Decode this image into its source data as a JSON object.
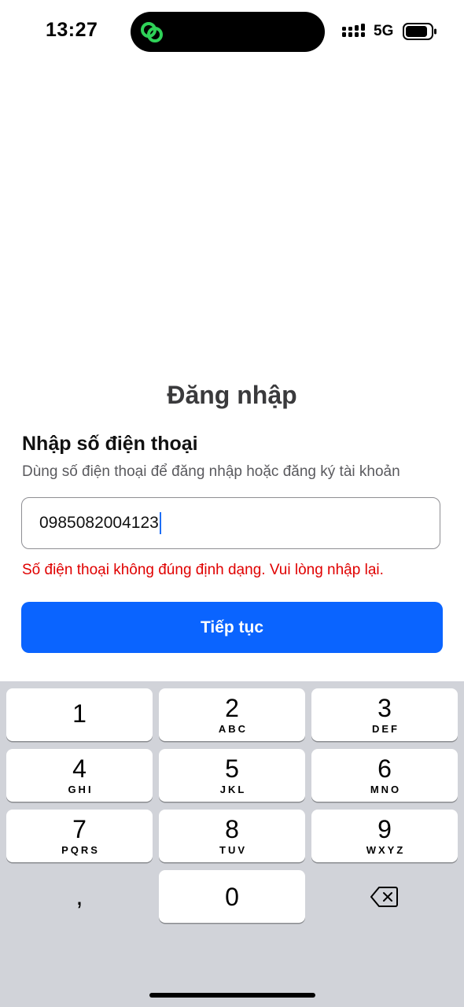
{
  "status_bar": {
    "time": "13:27",
    "network": "5G",
    "icons": [
      "app-link-icon",
      "signal-icon",
      "battery-icon"
    ]
  },
  "login": {
    "title": "Đăng nhập",
    "section_title": "Nhập số điện thoại",
    "section_subtitle": "Dùng số điện thoại để đăng nhập hoặc đăng ký tài khoản",
    "phone_value": "0985082004123",
    "error_message": "Số điện thoại không đúng định dạng. Vui lòng nhập lại.",
    "continue_label": "Tiếp tục"
  },
  "keyboard": {
    "keys": [
      {
        "digit": "1",
        "letters": ""
      },
      {
        "digit": "2",
        "letters": "ABC"
      },
      {
        "digit": "3",
        "letters": "DEF"
      },
      {
        "digit": "4",
        "letters": "GHI"
      },
      {
        "digit": "5",
        "letters": "JKL"
      },
      {
        "digit": "6",
        "letters": "MNO"
      },
      {
        "digit": "7",
        "letters": "PQRS"
      },
      {
        "digit": "8",
        "letters": "TUV"
      },
      {
        "digit": "9",
        "letters": "WXYZ"
      },
      {
        "digit": "0",
        "letters": ""
      }
    ],
    "comma_label": ",",
    "delete_icon": "backspace-icon"
  },
  "colors": {
    "accent": "#0a64ff",
    "error": "#e00000",
    "keyboard_bg": "#d1d3d9",
    "island_icon": "#2fd158"
  }
}
